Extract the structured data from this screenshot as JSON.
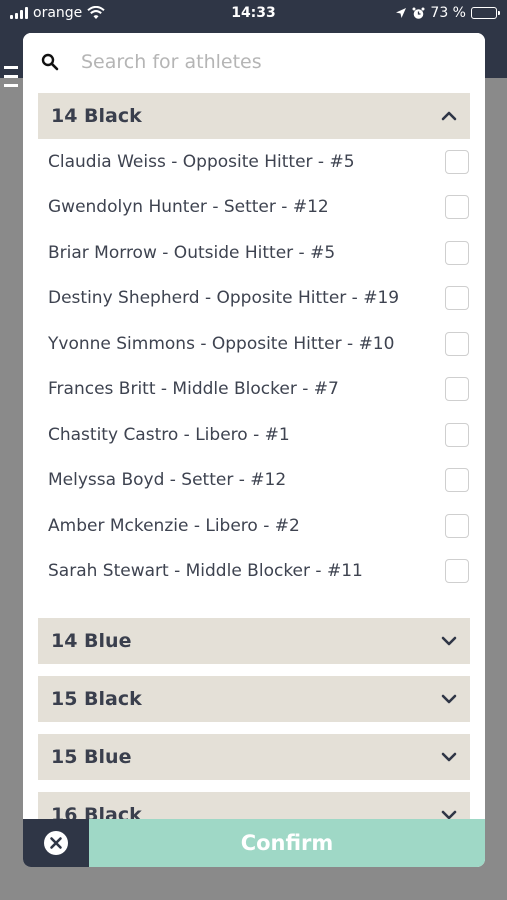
{
  "status_bar": {
    "carrier": "orange",
    "time": "14:33",
    "battery": "73 %",
    "battery_level": 0.73
  },
  "search": {
    "placeholder": "Search for athletes",
    "value": ""
  },
  "groups": [
    {
      "title": "14 Black",
      "expanded": true,
      "athletes": [
        "Claudia Weiss - Opposite Hitter - #5",
        "Gwendolyn Hunter - Setter - #12",
        "Briar Morrow - Outside Hitter - #5",
        "Destiny Shepherd - Opposite Hitter - #19",
        "Yvonne Simmons - Opposite Hitter - #10",
        "Frances Britt - Middle Blocker - #7",
        "Chastity Castro - Libero - #1",
        "Melyssa Boyd - Setter - #12",
        "Amber Mckenzie - Libero - #2",
        "Sarah Stewart - Middle Blocker - #11"
      ]
    },
    {
      "title": "14 Blue",
      "expanded": false
    },
    {
      "title": "15 Black",
      "expanded": false
    },
    {
      "title": "15 Blue",
      "expanded": false
    },
    {
      "title": "16 Black",
      "expanded": false
    }
  ],
  "footer": {
    "confirm_label": "Confirm"
  },
  "icons": {
    "search": "search-icon",
    "cancel": "close-circle-icon",
    "expanded": "chevron-up-icon",
    "collapsed": "chevron-down-icon"
  },
  "colors": {
    "dark": "#2f3646",
    "group_header": "#e4e0d7",
    "confirm": "#9fd8c6"
  }
}
